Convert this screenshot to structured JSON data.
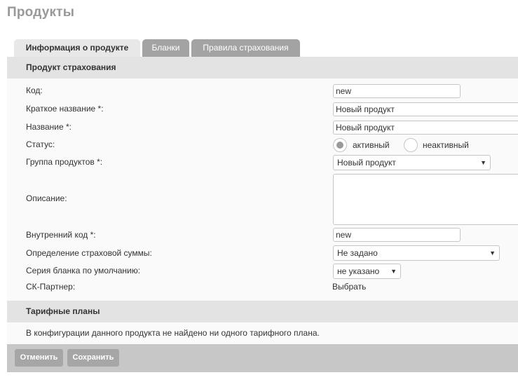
{
  "page": {
    "title": "Продукты"
  },
  "tabs": [
    {
      "label": "Информация о продукте",
      "active": true
    },
    {
      "label": "Бланки",
      "active": false
    },
    {
      "label": "Правила страхования",
      "active": false
    }
  ],
  "product_section": {
    "header": "Продукт страхования",
    "fields": {
      "code": {
        "label": "Код:",
        "value": "new"
      },
      "short_name": {
        "label": "Краткое название *:",
        "value": "Новый продукт"
      },
      "name": {
        "label": "Название *:",
        "value": "Новый продукт"
      },
      "status": {
        "label": "Статус:",
        "options": [
          "активный",
          "неактивный"
        ],
        "selected": "активный"
      },
      "product_group": {
        "label": "Группа продуктов *:",
        "value": "Новый продукт"
      },
      "description": {
        "label": "Описание:",
        "value": ""
      },
      "internal_code": {
        "label": "Внутренний код *:",
        "value": "new"
      },
      "sum_insured": {
        "label": "Определение страховой суммы:",
        "value": "Не задано"
      },
      "form_series": {
        "label": "Серия бланка по умолчанию:",
        "value": "не указано"
      },
      "partner": {
        "label": "СК-Партнер:",
        "action": "Выбрать"
      }
    }
  },
  "tariff_section": {
    "header": "Тарифные планы",
    "message": "В конфигурации данного продукта не найдено ни одного тарифного плана."
  },
  "footer": {
    "cancel_label": "Отменить",
    "save_label": "Сохранить"
  },
  "colors": {
    "tab_active_bg": "#e8e8e8",
    "tab_inactive_bg": "#a3a3a3",
    "section_header_bg": "#e3e3e3",
    "footer_bg": "#c7c7c7",
    "button_bg": "#a6a6a6",
    "title_color": "#999999"
  },
  "icons": {
    "select_arrow": "triangle-down-icon"
  }
}
